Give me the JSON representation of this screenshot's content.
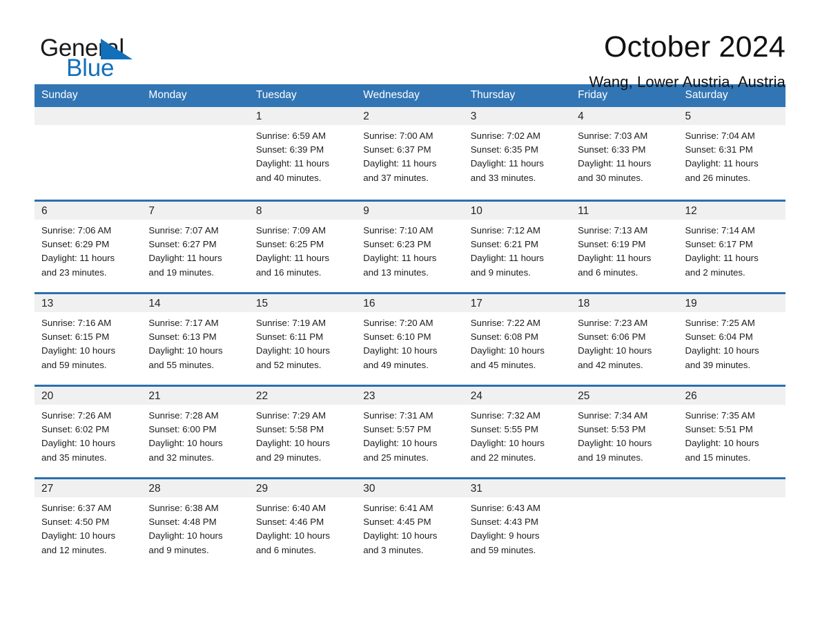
{
  "logo": {
    "word_one": "General",
    "word_two": "Blue",
    "triangle_color": "#1270ba"
  },
  "header": {
    "month_title": "October 2024",
    "location": "Wang, Lower Austria, Austria",
    "accent_color": "#3275b4"
  },
  "weekday_headers": [
    "Sunday",
    "Monday",
    "Tuesday",
    "Wednesday",
    "Thursday",
    "Friday",
    "Saturday"
  ],
  "weeks": [
    [
      {
        "day": "",
        "lines": []
      },
      {
        "day": "",
        "lines": []
      },
      {
        "day": "1",
        "lines": [
          "Sunrise: 6:59 AM",
          "Sunset: 6:39 PM",
          "Daylight: 11 hours",
          "and 40 minutes."
        ]
      },
      {
        "day": "2",
        "lines": [
          "Sunrise: 7:00 AM",
          "Sunset: 6:37 PM",
          "Daylight: 11 hours",
          "and 37 minutes."
        ]
      },
      {
        "day": "3",
        "lines": [
          "Sunrise: 7:02 AM",
          "Sunset: 6:35 PM",
          "Daylight: 11 hours",
          "and 33 minutes."
        ]
      },
      {
        "day": "4",
        "lines": [
          "Sunrise: 7:03 AM",
          "Sunset: 6:33 PM",
          "Daylight: 11 hours",
          "and 30 minutes."
        ]
      },
      {
        "day": "5",
        "lines": [
          "Sunrise: 7:04 AM",
          "Sunset: 6:31 PM",
          "Daylight: 11 hours",
          "and 26 minutes."
        ]
      }
    ],
    [
      {
        "day": "6",
        "lines": [
          "Sunrise: 7:06 AM",
          "Sunset: 6:29 PM",
          "Daylight: 11 hours",
          "and 23 minutes."
        ]
      },
      {
        "day": "7",
        "lines": [
          "Sunrise: 7:07 AM",
          "Sunset: 6:27 PM",
          "Daylight: 11 hours",
          "and 19 minutes."
        ]
      },
      {
        "day": "8",
        "lines": [
          "Sunrise: 7:09 AM",
          "Sunset: 6:25 PM",
          "Daylight: 11 hours",
          "and 16 minutes."
        ]
      },
      {
        "day": "9",
        "lines": [
          "Sunrise: 7:10 AM",
          "Sunset: 6:23 PM",
          "Daylight: 11 hours",
          "and 13 minutes."
        ]
      },
      {
        "day": "10",
        "lines": [
          "Sunrise: 7:12 AM",
          "Sunset: 6:21 PM",
          "Daylight: 11 hours",
          "and 9 minutes."
        ]
      },
      {
        "day": "11",
        "lines": [
          "Sunrise: 7:13 AM",
          "Sunset: 6:19 PM",
          "Daylight: 11 hours",
          "and 6 minutes."
        ]
      },
      {
        "day": "12",
        "lines": [
          "Sunrise: 7:14 AM",
          "Sunset: 6:17 PM",
          "Daylight: 11 hours",
          "and 2 minutes."
        ]
      }
    ],
    [
      {
        "day": "13",
        "lines": [
          "Sunrise: 7:16 AM",
          "Sunset: 6:15 PM",
          "Daylight: 10 hours",
          "and 59 minutes."
        ]
      },
      {
        "day": "14",
        "lines": [
          "Sunrise: 7:17 AM",
          "Sunset: 6:13 PM",
          "Daylight: 10 hours",
          "and 55 minutes."
        ]
      },
      {
        "day": "15",
        "lines": [
          "Sunrise: 7:19 AM",
          "Sunset: 6:11 PM",
          "Daylight: 10 hours",
          "and 52 minutes."
        ]
      },
      {
        "day": "16",
        "lines": [
          "Sunrise: 7:20 AM",
          "Sunset: 6:10 PM",
          "Daylight: 10 hours",
          "and 49 minutes."
        ]
      },
      {
        "day": "17",
        "lines": [
          "Sunrise: 7:22 AM",
          "Sunset: 6:08 PM",
          "Daylight: 10 hours",
          "and 45 minutes."
        ]
      },
      {
        "day": "18",
        "lines": [
          "Sunrise: 7:23 AM",
          "Sunset: 6:06 PM",
          "Daylight: 10 hours",
          "and 42 minutes."
        ]
      },
      {
        "day": "19",
        "lines": [
          "Sunrise: 7:25 AM",
          "Sunset: 6:04 PM",
          "Daylight: 10 hours",
          "and 39 minutes."
        ]
      }
    ],
    [
      {
        "day": "20",
        "lines": [
          "Sunrise: 7:26 AM",
          "Sunset: 6:02 PM",
          "Daylight: 10 hours",
          "and 35 minutes."
        ]
      },
      {
        "day": "21",
        "lines": [
          "Sunrise: 7:28 AM",
          "Sunset: 6:00 PM",
          "Daylight: 10 hours",
          "and 32 minutes."
        ]
      },
      {
        "day": "22",
        "lines": [
          "Sunrise: 7:29 AM",
          "Sunset: 5:58 PM",
          "Daylight: 10 hours",
          "and 29 minutes."
        ]
      },
      {
        "day": "23",
        "lines": [
          "Sunrise: 7:31 AM",
          "Sunset: 5:57 PM",
          "Daylight: 10 hours",
          "and 25 minutes."
        ]
      },
      {
        "day": "24",
        "lines": [
          "Sunrise: 7:32 AM",
          "Sunset: 5:55 PM",
          "Daylight: 10 hours",
          "and 22 minutes."
        ]
      },
      {
        "day": "25",
        "lines": [
          "Sunrise: 7:34 AM",
          "Sunset: 5:53 PM",
          "Daylight: 10 hours",
          "and 19 minutes."
        ]
      },
      {
        "day": "26",
        "lines": [
          "Sunrise: 7:35 AM",
          "Sunset: 5:51 PM",
          "Daylight: 10 hours",
          "and 15 minutes."
        ]
      }
    ],
    [
      {
        "day": "27",
        "lines": [
          "Sunrise: 6:37 AM",
          "Sunset: 4:50 PM",
          "Daylight: 10 hours",
          "and 12 minutes."
        ]
      },
      {
        "day": "28",
        "lines": [
          "Sunrise: 6:38 AM",
          "Sunset: 4:48 PM",
          "Daylight: 10 hours",
          "and 9 minutes."
        ]
      },
      {
        "day": "29",
        "lines": [
          "Sunrise: 6:40 AM",
          "Sunset: 4:46 PM",
          "Daylight: 10 hours",
          "and 6 minutes."
        ]
      },
      {
        "day": "30",
        "lines": [
          "Sunrise: 6:41 AM",
          "Sunset: 4:45 PM",
          "Daylight: 10 hours",
          "and 3 minutes."
        ]
      },
      {
        "day": "31",
        "lines": [
          "Sunrise: 6:43 AM",
          "Sunset: 4:43 PM",
          "Daylight: 9 hours",
          "and 59 minutes."
        ]
      },
      {
        "day": "",
        "lines": []
      },
      {
        "day": "",
        "lines": []
      }
    ]
  ]
}
